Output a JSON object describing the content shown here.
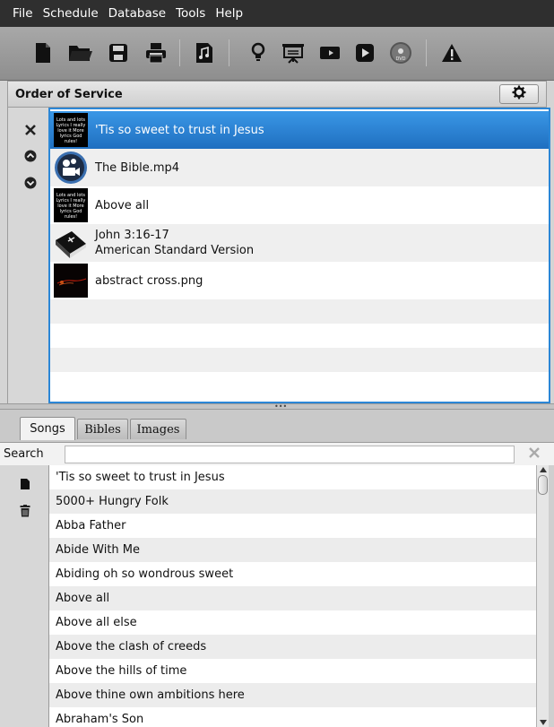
{
  "menubar": {
    "items": [
      "File",
      "Schedule",
      "Database",
      "Tools",
      "Help"
    ]
  },
  "toolbar": {
    "buttons": [
      {
        "name": "new-schedule-icon"
      },
      {
        "name": "open-folder-icon"
      },
      {
        "name": "save-icon"
      },
      {
        "name": "print-icon"
      },
      {
        "name": "song-music-icon"
      },
      {
        "name": "notice-bulb-icon"
      },
      {
        "name": "presentation-icon"
      },
      {
        "name": "video-camera-icon"
      },
      {
        "name": "play-icon"
      },
      {
        "name": "dvd-icon"
      },
      {
        "name": "warning-icon"
      }
    ]
  },
  "order_of_service": {
    "title": "Order of Service",
    "items": [
      {
        "line1": "'Tis so sweet to trust in Jesus",
        "line2": "",
        "type": "song",
        "selected": true
      },
      {
        "line1": "The Bible.mp4",
        "line2": "",
        "type": "video",
        "selected": false
      },
      {
        "line1": "Above all",
        "line2": "",
        "type": "song",
        "selected": false
      },
      {
        "line1": "John 3:16-17",
        "line2": "American Standard Version",
        "type": "bible",
        "selected": false
      },
      {
        "line1": "abstract cross.png",
        "line2": "",
        "type": "image",
        "selected": false
      }
    ],
    "lyric_thumb_text": "Lots and lots Lyrics I really love it More lyrics God rules!"
  },
  "library": {
    "tabs": [
      "Songs",
      "Bibles",
      "Images"
    ],
    "active_tab": "Songs",
    "search_label": "Search",
    "search_value": "",
    "songs": [
      "'Tis so sweet to trust in Jesus",
      "5000+ Hungry Folk",
      "Abba Father",
      "Abide With Me",
      "Abiding oh so wondrous sweet",
      "Above all",
      "Above all else",
      "Above the clash of creeds",
      "Above the hills of time",
      "Above thine own ambitions here",
      "Abraham's Son"
    ]
  },
  "colors": {
    "selection": "#2b86d6",
    "menubar": "#2f2f2f"
  }
}
